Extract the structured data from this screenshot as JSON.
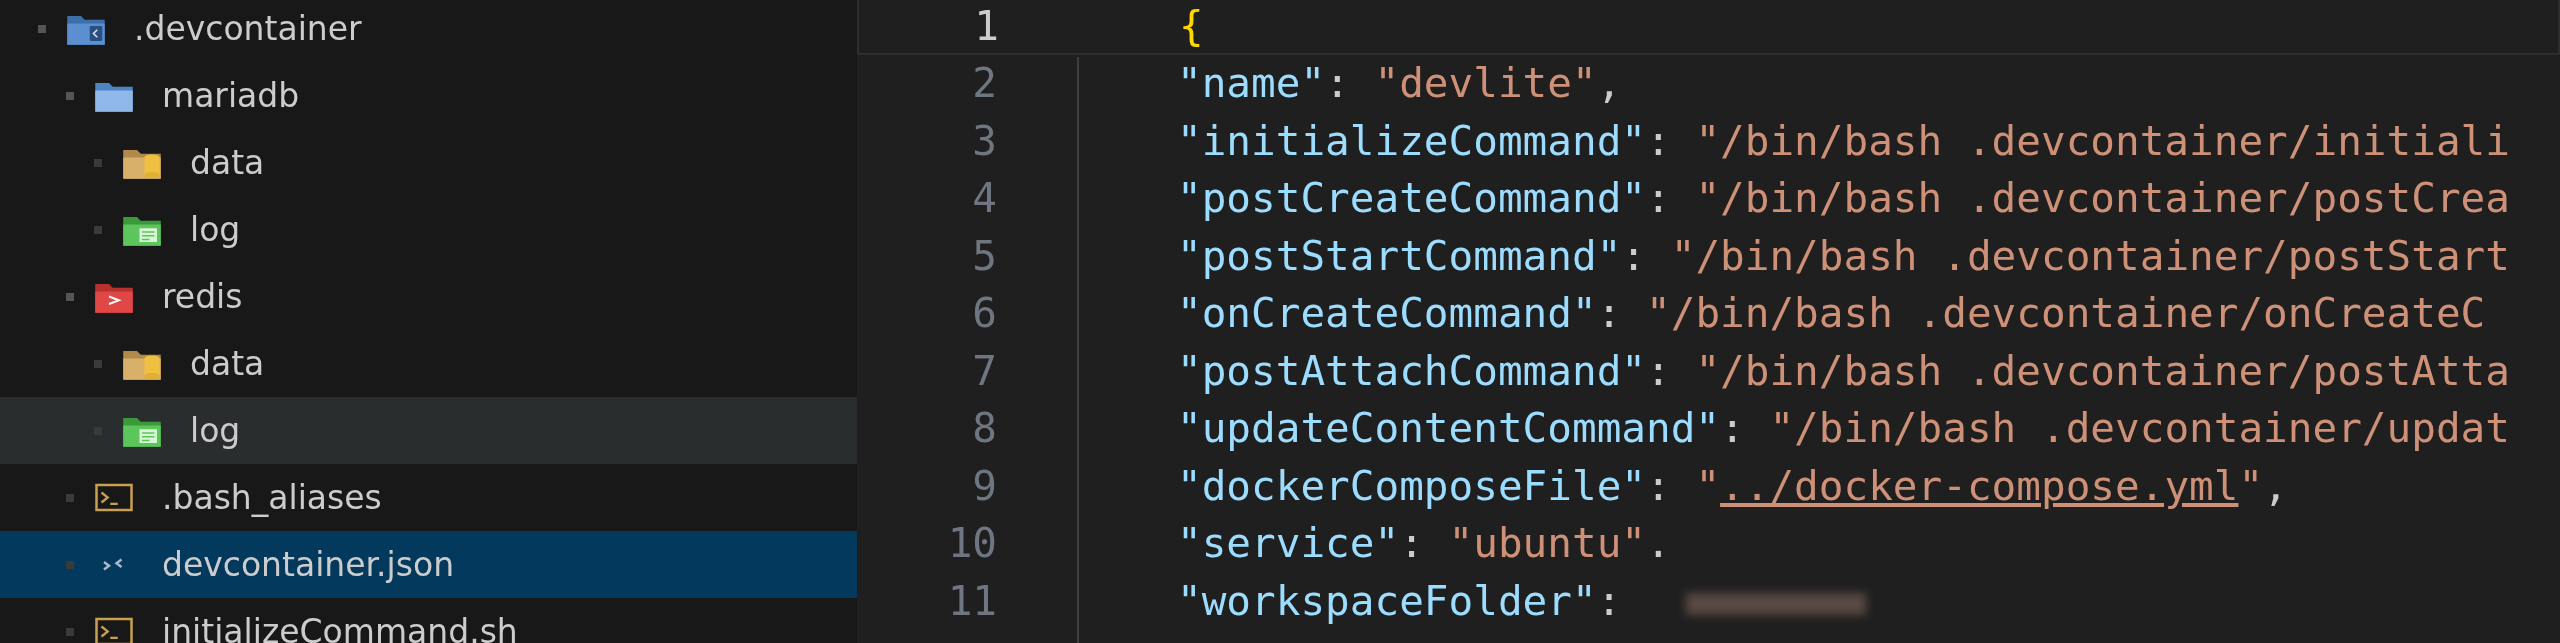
{
  "explorer": {
    "tree": [
      {
        "label": ".devcontainer",
        "kind": "folder-devcontainer",
        "expanded": true,
        "selected": false,
        "hovered": false,
        "children": [
          {
            "label": "mariadb",
            "kind": "folder-mariadb",
            "expanded": true,
            "selected": false,
            "hovered": false,
            "children": [
              {
                "label": "data",
                "kind": "folder-data",
                "expanded": false,
                "selected": false,
                "hovered": false
              },
              {
                "label": "log",
                "kind": "folder-log",
                "expanded": false,
                "selected": false,
                "hovered": false
              }
            ]
          },
          {
            "label": "redis",
            "kind": "folder-redis",
            "expanded": true,
            "selected": false,
            "hovered": false,
            "children": [
              {
                "label": "data",
                "kind": "folder-data",
                "expanded": false,
                "selected": false,
                "hovered": false
              },
              {
                "label": "log",
                "kind": "folder-log",
                "expanded": false,
                "selected": false,
                "hovered": true
              }
            ]
          },
          {
            "label": ".bash_aliases",
            "kind": "file-shell",
            "selected": false,
            "hovered": false
          },
          {
            "label": "devcontainer.json",
            "kind": "file-json",
            "selected": true,
            "hovered": false
          },
          {
            "label": "initializeCommand.sh",
            "kind": "file-shell",
            "selected": false,
            "hovered": false
          }
        ]
      }
    ]
  },
  "editor": {
    "lines": [
      {
        "number": "1",
        "active": true,
        "tokens": [
          {
            "kind": "brace",
            "text": "{"
          }
        ]
      },
      {
        "number": "2",
        "active": false,
        "tokens": [
          {
            "kind": "key",
            "text": "\"name\""
          },
          {
            "kind": "punct",
            "text": ": "
          },
          {
            "kind": "string",
            "text": "\"devlite\""
          },
          {
            "kind": "punct",
            "text": ","
          }
        ]
      },
      {
        "number": "3",
        "active": false,
        "tokens": [
          {
            "kind": "key",
            "text": "\"initializeCommand\""
          },
          {
            "kind": "punct",
            "text": ": "
          },
          {
            "kind": "string",
            "text": "\"/bin/bash .devcontainer/initiali"
          }
        ]
      },
      {
        "number": "4",
        "active": false,
        "tokens": [
          {
            "kind": "key",
            "text": "\"postCreateCommand\""
          },
          {
            "kind": "punct",
            "text": ": "
          },
          {
            "kind": "string",
            "text": "\"/bin/bash .devcontainer/postCrea"
          }
        ]
      },
      {
        "number": "5",
        "active": false,
        "tokens": [
          {
            "kind": "key",
            "text": "\"postStartCommand\""
          },
          {
            "kind": "punct",
            "text": ": "
          },
          {
            "kind": "string",
            "text": "\"/bin/bash .devcontainer/postStart"
          }
        ]
      },
      {
        "number": "6",
        "active": false,
        "tokens": [
          {
            "kind": "key",
            "text": "\"onCreateCommand\""
          },
          {
            "kind": "punct",
            "text": ": "
          },
          {
            "kind": "string",
            "text": "\"/bin/bash .devcontainer/onCreateC"
          }
        ]
      },
      {
        "number": "7",
        "active": false,
        "tokens": [
          {
            "kind": "key",
            "text": "\"postAttachCommand\""
          },
          {
            "kind": "punct",
            "text": ": "
          },
          {
            "kind": "string",
            "text": "\"/bin/bash .devcontainer/postAtta"
          }
        ]
      },
      {
        "number": "8",
        "active": false,
        "tokens": [
          {
            "kind": "key",
            "text": "\"updateContentCommand\""
          },
          {
            "kind": "punct",
            "text": ": "
          },
          {
            "kind": "string",
            "text": "\"/bin/bash .devcontainer/updat"
          }
        ]
      },
      {
        "number": "9",
        "active": false,
        "tokens": [
          {
            "kind": "key",
            "text": "\"dockerComposeFile\""
          },
          {
            "kind": "punct",
            "text": ": "
          },
          {
            "kind": "string",
            "text": "\""
          },
          {
            "kind": "link",
            "text": "../docker-compose.yml"
          },
          {
            "kind": "string",
            "text": "\""
          },
          {
            "kind": "punct",
            "text": ","
          }
        ]
      },
      {
        "number": "10",
        "active": false,
        "tokens": [
          {
            "kind": "key",
            "text": "\"service\""
          },
          {
            "kind": "punct",
            "text": ": "
          },
          {
            "kind": "string",
            "text": "\"ubuntu\""
          },
          {
            "kind": "punct",
            "text": "."
          }
        ]
      },
      {
        "number": "11",
        "active": false,
        "tokens": [
          {
            "kind": "key",
            "text": "\"workspaceFolder\""
          },
          {
            "kind": "punct",
            "text": ": "
          },
          {
            "kind": "redacted"
          }
        ]
      }
    ]
  }
}
